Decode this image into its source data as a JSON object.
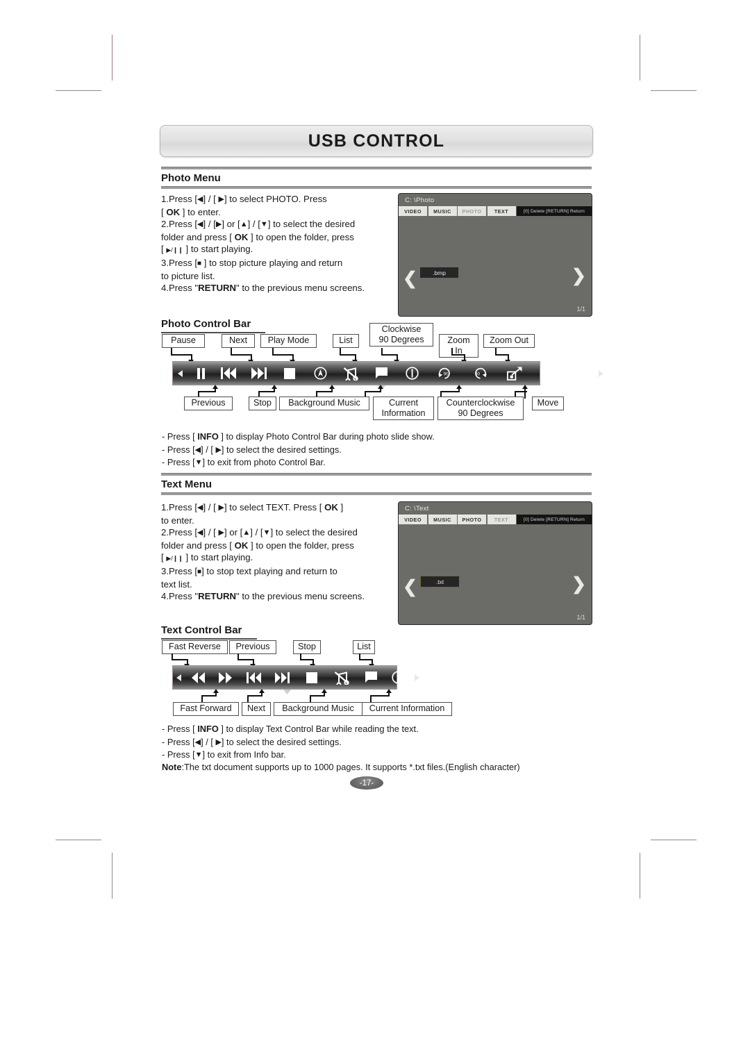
{
  "banner": {
    "title": "USB CONTROL"
  },
  "sections": {
    "photo_menu": {
      "heading": "Photo Menu",
      "steps": [
        "1.Press [◀] / [ ▶] to select PHOTO. Press",
        "[ OK ] to enter.",
        "2.Press [◀] / [▶] or [▲] / [▼] to select the desired",
        "folder and press [ OK ] to open the folder, press",
        "[ ▶/❙❙ ] to start playing.",
        "3.Press [ ■ ] to stop picture playing and return",
        "to picture list.",
        "4.Press \"RETURN\" to the previous menu screens."
      ]
    },
    "photo_control_bar": {
      "heading": "Photo Control Bar"
    },
    "text_menu": {
      "heading": "Text Menu",
      "steps": [
        "1.Press [◀] / [ ▶] to select TEXT. Press [ OK ]",
        "to enter.",
        "2.Press [◀] / [ ▶] or [▲] / [▼] to select the desired",
        "folder and press [ OK ] to open the folder, press",
        "[ ▶/❙❙ ] to start playing.",
        "3.Press [ ■ ] to stop text playing and return to",
        "text list.",
        "4.Press \"RETURN\" to the previous menu screens."
      ]
    },
    "text_control_bar": {
      "heading": "Text Control Bar"
    }
  },
  "photo_screen": {
    "path": "C: \\Photo",
    "tabs": [
      {
        "label": "VIDEO",
        "active": false
      },
      {
        "label": "MUSIC",
        "active": false
      },
      {
        "label": "PHOTO",
        "active": true
      },
      {
        "label": "TEXT",
        "active": false
      }
    ],
    "actions": "[0] Delete  [RETURN] Return",
    "file": ".bmp",
    "page_indicator": "1/1",
    "prev_arrow": "❮",
    "next_arrow": "❯"
  },
  "text_screen": {
    "path": "C: \\Text",
    "tabs": [
      {
        "label": "VIDEO",
        "active": false
      },
      {
        "label": "MUSIC",
        "active": false
      },
      {
        "label": "PHOTO",
        "active": false
      },
      {
        "label": "TEXT",
        "active": true
      }
    ],
    "actions": "[0] Delete  [RETURN] Return",
    "file": ".txt",
    "page_indicator": "1/1",
    "prev_arrow": "❮",
    "next_arrow": "❯"
  },
  "photo_bar_labels_top": [
    "Pause",
    "Next",
    "Play Mode",
    "List",
    "Clockwise\n90 Degrees",
    "Zoom In",
    "Zoom Out"
  ],
  "photo_bar_labels_bottom": [
    "Previous",
    "Stop",
    "Background Music",
    "Current\nInformation",
    "Counterclockwise\n90 Degrees",
    "Move"
  ],
  "photo_bar_icons": [
    "scroll-left-icon",
    "pause-icon",
    "previous-icon",
    "next-icon",
    "stop-icon",
    "play-mode-icon",
    "background-music-icon",
    "list-icon",
    "current-information-icon",
    "rotate-clockwise-90-icon",
    "rotate-counterclockwise-90-icon",
    "zoom-in-icon",
    "zoom-out-icon",
    "move-icon",
    "scroll-right-icon"
  ],
  "photo_notes": [
    "- Press [ INFO ] to display Photo Control Bar during photo slide show.",
    "- Press [◀] / [ ▶]  to select the desired settings.",
    "- Press [▼] to exit from photo Control Bar."
  ],
  "text_bar_labels_top": [
    "Fast Reverse",
    "Previous",
    "Stop",
    "List"
  ],
  "text_bar_labels_bottom": [
    "Fast Forward",
    "Next",
    "Background Music",
    "Current Information"
  ],
  "text_bar_icons": [
    "scroll-left-icon",
    "fast-reverse-icon",
    "fast-forward-icon",
    "previous-icon",
    "next-icon",
    "stop-icon",
    "background-music-icon",
    "list-icon",
    "current-information-icon",
    "scroll-right-icon"
  ],
  "text_notes": [
    "- Press [ INFO ] to display Text Control Bar while reading the text.",
    "- Press [◀] / [ ▶]  to select the desired settings.",
    "- Press [▼] to exit from Info bar."
  ],
  "footer_note": "Note:The txt document supports up to 1000 pages. It supports *.txt files.(English character)",
  "page_number": "-17-"
}
